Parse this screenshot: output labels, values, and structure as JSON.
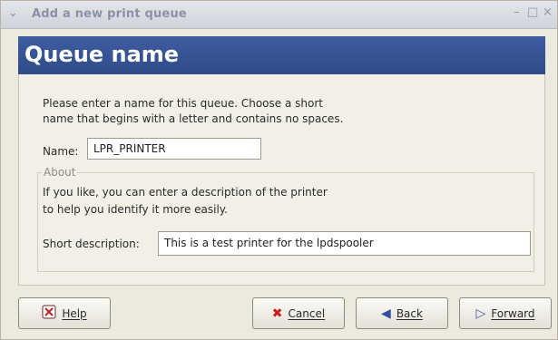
{
  "window": {
    "title": "Add a new print queue",
    "controls": {
      "minimize": "–",
      "maximize": "□",
      "close": "×"
    }
  },
  "header": {
    "title": "Queue name"
  },
  "form": {
    "instructions": "Please enter a name for this queue.  Choose a short\nname that begins with a letter and contains no spaces.",
    "name_label": "Name:",
    "name_value": "LPR_PRINTER",
    "about": {
      "legend": "About",
      "text": "If you like, you can enter a description of the printer\nto help you identify it more easily.",
      "short_label": "Short description:",
      "short_value": "This is a test printer for the lpdspooler"
    }
  },
  "buttons": {
    "help": {
      "label": "Help",
      "icon": "help-icon"
    },
    "cancel": {
      "label": "Cancel",
      "icon": "cancel-icon"
    },
    "back": {
      "label": "Back",
      "icon": "back-arrow-icon"
    },
    "forward": {
      "label": "Forward",
      "icon": "forward-arrow-icon"
    }
  },
  "colors": {
    "header_band": "#2f4b8a",
    "window_bg": "#eceadf",
    "cancel_icon": "#d01818",
    "arrow_icon": "#3450a0"
  }
}
